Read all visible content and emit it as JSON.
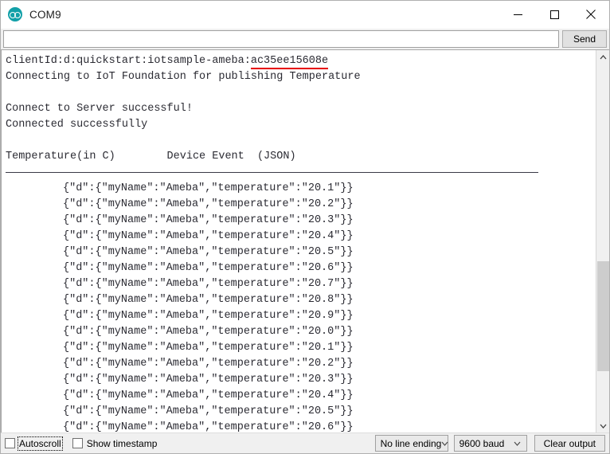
{
  "window": {
    "title": "COM9",
    "icon": "arduino-logo-icon",
    "controls": {
      "minimize": "minimize-icon",
      "maximize": "maximize-icon",
      "close": "close-icon"
    }
  },
  "send_row": {
    "input_value": "",
    "input_placeholder": "",
    "send_label": "Send"
  },
  "console": {
    "header_lines": [
      {
        "text": "clientId:d:quickstart:iotsample-ameba:",
        "underlined_text": "ac35ee15608e"
      },
      {
        "text": "Connecting to IoT Foundation for publishing Temperature"
      },
      {
        "text": ""
      },
      {
        "text": "Connect to Server successful!"
      },
      {
        "text": "Connected successfully"
      },
      {
        "text": ""
      },
      {
        "text": "Temperature(in C)        Device Event  (JSON)"
      }
    ],
    "separator": true,
    "device_name": "Ameba",
    "temperatures": [
      "20.1",
      "20.2",
      "20.3",
      "20.4",
      "20.5",
      "20.6",
      "20.7",
      "20.8",
      "20.9",
      "20.0",
      "20.1",
      "20.2",
      "20.3",
      "20.4",
      "20.5",
      "20.6"
    ],
    "event_template_prefix": "{\"d\":{\"myName\":\"",
    "event_template_middle": "\",\"temperature\":\"",
    "event_template_suffix": "\"}}"
  },
  "scrollbar": {
    "up_icon": "chevron-up-icon",
    "down_icon": "chevron-down-icon",
    "thumb": "scrollbar-thumb"
  },
  "statusbar": {
    "autoscroll_label": "Autoscroll",
    "autoscroll_checked": false,
    "show_timestamp_label": "Show timestamp",
    "show_timestamp_checked": false,
    "line_ending_value": "No line ending",
    "baud_value": "9600 baud",
    "clear_output_label": "Clear output"
  },
  "colors": {
    "accent_teal": "#12a0a8",
    "underline_red": "#e60000",
    "window_chrome": "#f0f0f0",
    "console_bg": "#ffffff",
    "console_text": "#2b2b33"
  }
}
